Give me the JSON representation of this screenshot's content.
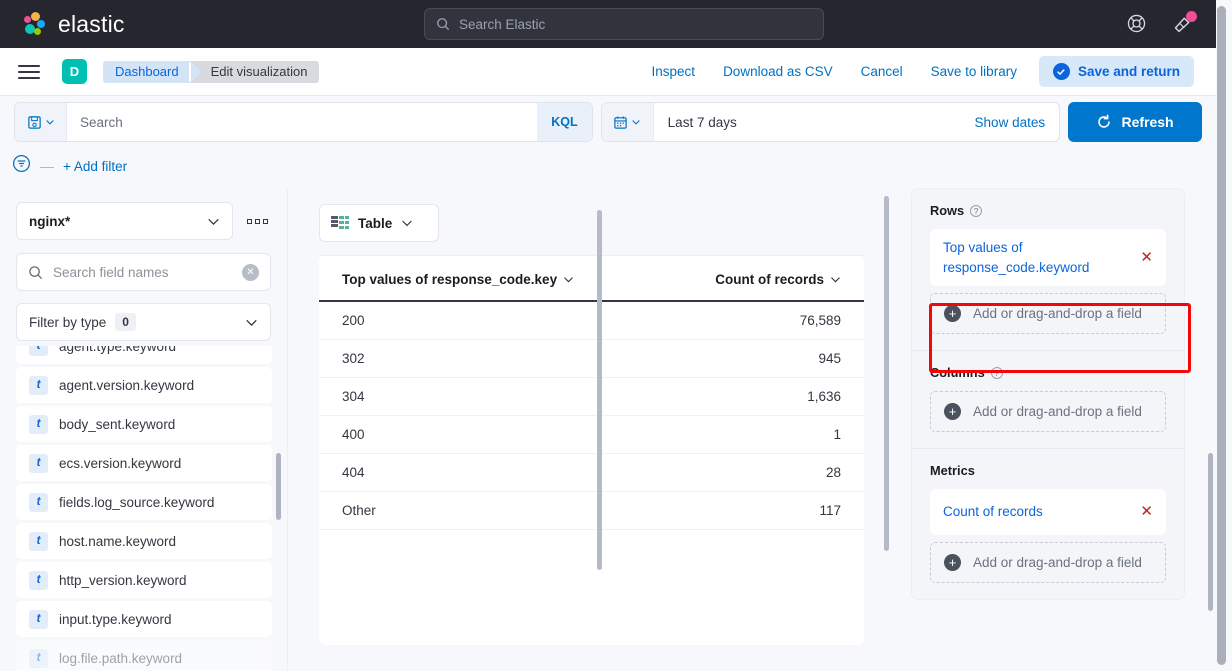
{
  "global_header": {
    "brand_name": "elastic",
    "search_placeholder": "Search Elastic",
    "search_icon": "search-icon",
    "help_icon": "help-lifesaver-icon",
    "announcement_icon": "announcement-megaphone-icon",
    "notification_color": "#f04e98"
  },
  "chrome": {
    "menu_icon": "hamburger-menu-icon",
    "space_initial": "D",
    "space_color": "#00bfb3",
    "breadcrumbs": [
      {
        "label": "Dashboard"
      },
      {
        "label": "Edit visualization"
      }
    ],
    "actions": [
      {
        "label": "Inspect"
      },
      {
        "label": "Download as CSV"
      },
      {
        "label": "Cancel"
      },
      {
        "label": "Save to library"
      }
    ],
    "primary_action": {
      "label": "Save and return",
      "icon": "check-circle-icon"
    }
  },
  "query_bar": {
    "saved_query_icon": "save-disk-icon",
    "chevron_icon": "chevron-down-icon",
    "search_placeholder": "Search",
    "language_label": "KQL",
    "calendar_icon": "calendar-icon",
    "time_range": "Last 7 days",
    "show_dates_label": "Show dates",
    "refresh_label": "Refresh",
    "refresh_icon": "refresh-icon",
    "refresh_color": "#0077cc"
  },
  "filter_bar": {
    "filter_icon": "filter-funnel-icon",
    "separator": "—",
    "add_filter_label": "+ Add filter"
  },
  "data_panel": {
    "index_pattern": "nginx*",
    "index_chevron_icon": "chevron-down-icon",
    "more_icon": "boxes-horizontal-icon",
    "search_icon": "search-icon",
    "search_placeholder": "Search field names",
    "clear_icon": "clear-x-icon",
    "filter_by_type_label": "Filter by type",
    "filter_by_type_count": "0",
    "filter_chevron_icon": "chevron-down-icon",
    "field_type_glyph": "t",
    "fields": [
      {
        "name": "agent.type.keyword"
      },
      {
        "name": "agent.version.keyword"
      },
      {
        "name": "body_sent.keyword"
      },
      {
        "name": "ecs.version.keyword"
      },
      {
        "name": "fields.log_source.keyword"
      },
      {
        "name": "host.name.keyword"
      },
      {
        "name": "http_version.keyword"
      },
      {
        "name": "input.type.keyword"
      },
      {
        "name": "log.file.path.keyword"
      }
    ]
  },
  "chart_type": {
    "label": "Table",
    "icon": "table-icon",
    "chevron_icon": "chevron-down-icon"
  },
  "chart_data": {
    "type": "table",
    "title": "",
    "columns": [
      {
        "header": "Top values of response_code.key",
        "align": "left",
        "chevron_icon": "chevron-down-icon"
      },
      {
        "header": "Count of records",
        "align": "right",
        "chevron_icon": "chevron-down-icon"
      }
    ],
    "categories": [
      "200",
      "302",
      "304",
      "400",
      "404",
      "Other"
    ],
    "values": [
      76589,
      945,
      1636,
      1,
      28,
      117
    ],
    "rows": [
      {
        "label": "200",
        "count": "76,589"
      },
      {
        "label": "302",
        "count": "945"
      },
      {
        "label": "304",
        "count": "1,636"
      },
      {
        "label": "400",
        "count": "1"
      },
      {
        "label": "404",
        "count": "28"
      },
      {
        "label": "Other",
        "count": "117"
      }
    ],
    "xlabel": "Top values of response_code.key",
    "ylabel": "Count of records"
  },
  "config_panel": {
    "groups": [
      {
        "title": "Rows",
        "has_help": true,
        "help_icon": "help-question-icon",
        "chip": {
          "label": "Top values of response_code.keyword",
          "remove_icon": "remove-x-icon"
        },
        "drop_label": "Add or drag-and-drop a field",
        "drop_icon": "plus-circle-icon",
        "highlighted": true
      },
      {
        "title": "Columns",
        "has_help": true,
        "help_icon": "help-question-icon",
        "chip": null,
        "drop_label": "Add or drag-and-drop a field",
        "drop_icon": "plus-circle-icon",
        "highlighted": false
      },
      {
        "title": "Metrics",
        "has_help": false,
        "help_icon": "",
        "chip": {
          "label": "Count of records",
          "remove_icon": "remove-x-icon"
        },
        "drop_label": "Add or drag-and-drop a field",
        "drop_icon": "plus-circle-icon",
        "highlighted": false
      }
    ],
    "highlight_color": "#f50707"
  }
}
